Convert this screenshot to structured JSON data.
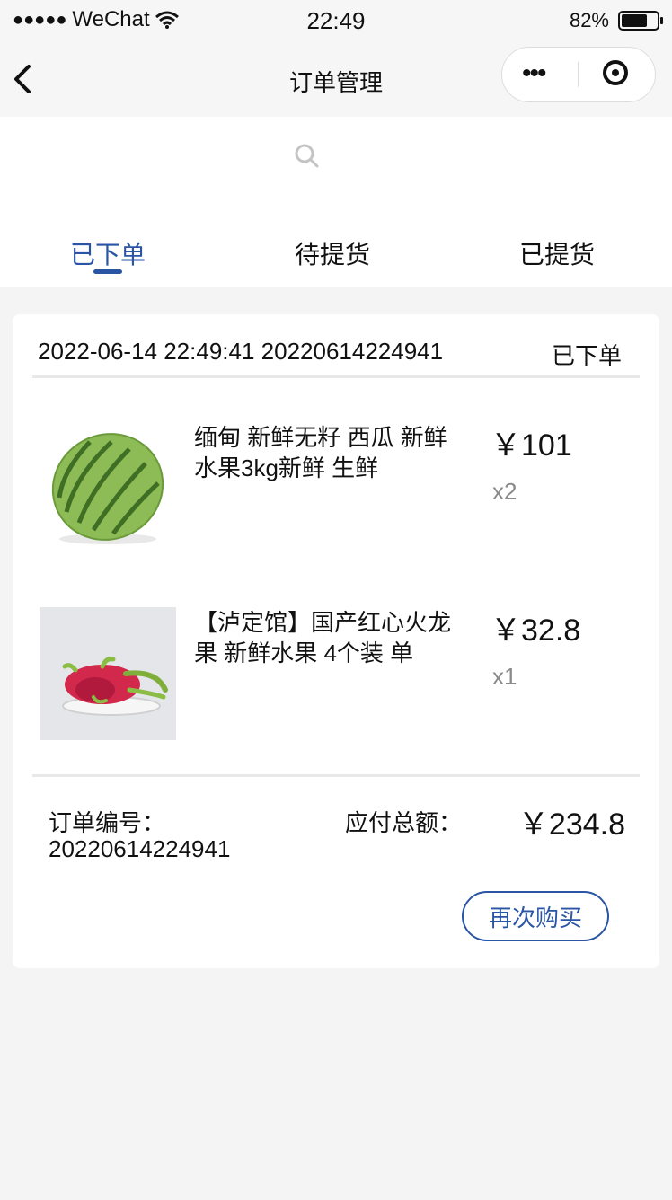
{
  "status_bar": {
    "signal": "●●●●●",
    "carrier": "WeChat",
    "time": "22:49",
    "battery_percent": "82%",
    "battery_level": 0.82
  },
  "navbar": {
    "title": "订单管理",
    "capsule_dots": "•••"
  },
  "tabs": [
    {
      "label": "已下单",
      "active": true
    },
    {
      "label": "待提货",
      "active": false
    },
    {
      "label": "已提货",
      "active": false
    }
  ],
  "order": {
    "header": "2022-06-14 22:49:41 20220614224941",
    "status": "已下单",
    "items": [
      {
        "title": "缅甸 新鲜无籽 西瓜 新鲜水果3kg新鲜 生鲜",
        "price": "￥101",
        "qty": "x2",
        "image_icon": "watermelon-image"
      },
      {
        "title": "【泸定馆】国产红心火龙果 新鲜水果 4个装 单",
        "price": "￥32.8",
        "qty": "x1",
        "image_icon": "dragon-fruit-image"
      }
    ],
    "order_no_label": "订单编号：",
    "order_no": "20220614224941",
    "total_label": "应付总额：",
    "total": "￥234.8",
    "rebuy_label": "再次购买"
  },
  "colors": {
    "accent": "#2a55a5",
    "background": "#f4f4f4",
    "muted": "#8a8a8a"
  }
}
